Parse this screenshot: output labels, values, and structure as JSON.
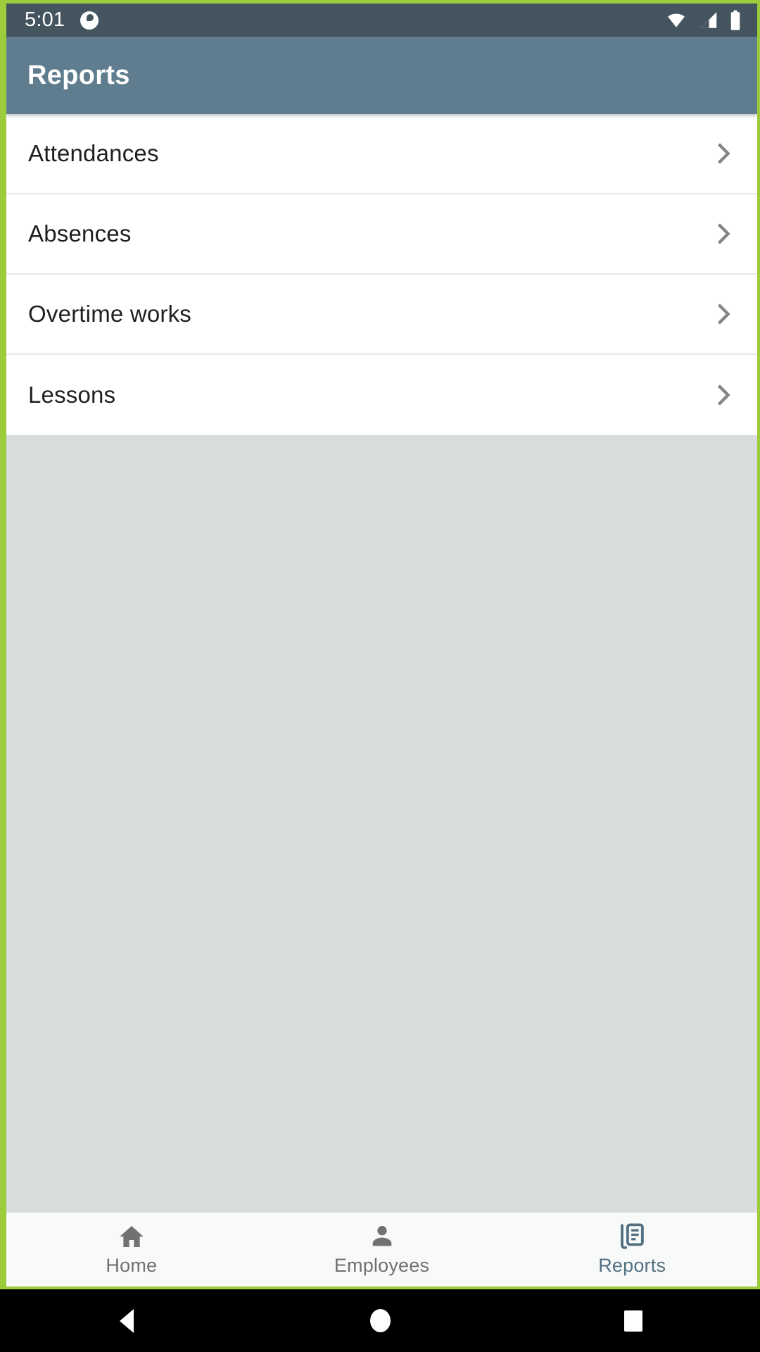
{
  "status_bar": {
    "time": "5:01",
    "app_notification_icon": "app-badge-icon",
    "wifi_icon": "wifi-icon",
    "cellular_icon": "cellular-signal-icon",
    "battery_icon": "battery-full-icon",
    "background_color": "#45555F",
    "foreground_color": "#FFFFFF"
  },
  "app_bar": {
    "title": "Reports",
    "background_color": "#5F7D8E",
    "title_color": "#FFFFFF"
  },
  "report_list": {
    "items": [
      {
        "label": "Attendances",
        "chevron_icon": "chevron-right-icon"
      },
      {
        "label": "Absences",
        "chevron_icon": "chevron-right-icon"
      },
      {
        "label": "Overtime works",
        "chevron_icon": "chevron-right-icon"
      },
      {
        "label": "Lessons",
        "chevron_icon": "chevron-right-icon"
      }
    ],
    "row_background_color": "#FFFFFF",
    "divider_color": "#E9E9E9",
    "label_color": "#1F1F1F",
    "chevron_color": "#858585"
  },
  "content_area": {
    "background_color": "#D8DCDC"
  },
  "bottom_nav": {
    "background_color": "#F8F9F9",
    "active_color": "#527082",
    "inactive_color": "#6F7173",
    "items": [
      {
        "label": "Home",
        "icon": "home-icon",
        "active": false
      },
      {
        "label": "Employees",
        "icon": "person-icon",
        "active": false
      },
      {
        "label": "Reports",
        "icon": "library-books-icon",
        "active": true
      }
    ]
  },
  "system_nav": {
    "background_color": "#000000",
    "back_label": "Back",
    "home_label": "Home",
    "recents_label": "Recent apps"
  },
  "frame": {
    "inspection_border_color": "#9CCB3B"
  }
}
